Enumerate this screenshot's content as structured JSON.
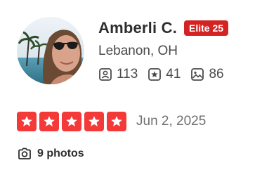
{
  "user": {
    "name": "Amberli C.",
    "elite_badge": "Elite 25",
    "location": "Lebanon, OH",
    "stats": [
      {
        "icon": "friends-icon",
        "value": "113"
      },
      {
        "icon": "reviews-icon",
        "value": "41"
      },
      {
        "icon": "photos-count-icon",
        "value": "86"
      }
    ]
  },
  "review": {
    "rating": 5,
    "rating_max": 5,
    "date": "Jun 2, 2025"
  },
  "photos": {
    "label": "9 photos",
    "icon": "camera-icon"
  },
  "colors": {
    "brand_red": "#d32323",
    "star_red": "#f43939",
    "text_dark": "#2d2e2f",
    "text_gray": "#6e7072"
  }
}
